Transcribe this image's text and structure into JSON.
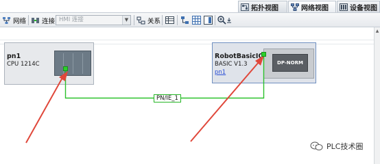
{
  "view_tabs": {
    "topology_view": "拓扑视图",
    "network_view": "网络视图",
    "device_view": "设备视图"
  },
  "toolbar": {
    "network_label": "网络",
    "connections_label": "连接",
    "hmi_connection_placeholder": "HMI 连接",
    "relations_label": "关系"
  },
  "devices": {
    "pn1": {
      "name": "pn1",
      "type": "CPU 1214C"
    },
    "robot": {
      "name": "RobotBasicIO",
      "type": "BASIC V1.3",
      "link": "pn1",
      "module_label": "DP-NORM"
    }
  },
  "network": {
    "subnet_label": "PN/IE_1"
  },
  "watermark": {
    "text": "PLC技术圈"
  },
  "colors": {
    "connection_green": "#2bc12b",
    "arrow_red": "#e0473a",
    "link_blue": "#2a4fd6"
  }
}
